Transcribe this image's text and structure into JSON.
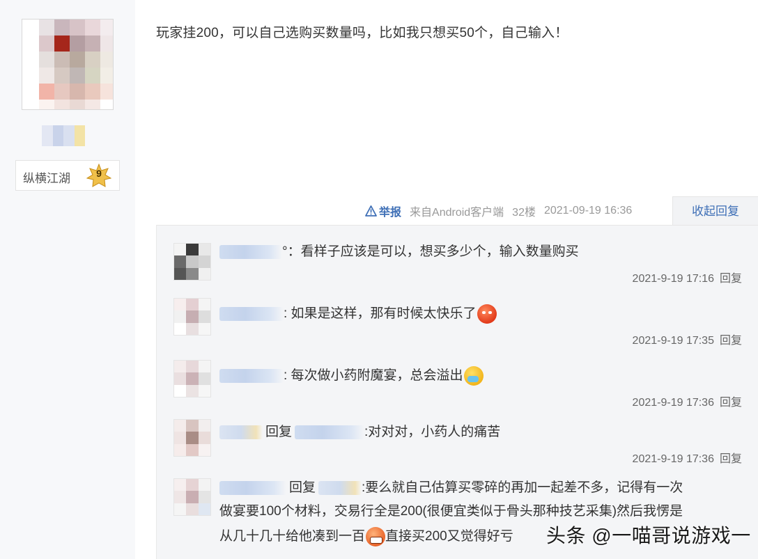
{
  "author": {
    "rank_title": "纵横江湖",
    "rank_level": "9"
  },
  "post": {
    "content": "玩家挂200，可以自己选购买数量吗，比如我只想买50个，自己输入！",
    "report_label": "举报",
    "source": "来自Android客户端",
    "floor": "32楼",
    "time": "2021-09-19 16:36",
    "collapse_label": "收起回复"
  },
  "comments": [
    {
      "text": "°：看样子应该是可以，想买多少个，输入数量购买",
      "time": "2021-9-19 17:16",
      "reply_label": "回复"
    },
    {
      "text": ": 如果是这样，那有时候太快乐了",
      "emoji": "angry-face",
      "time": "2021-9-19 17:35",
      "reply_label": "回复"
    },
    {
      "text": ": 每次做小药附魔宴，总会溢出",
      "emoji": "sick-face",
      "time": "2021-9-19 17:36",
      "reply_label": "回复"
    },
    {
      "reply_word": "回复",
      "text": ":对对对，小药人的痛苦",
      "time": "2021-9-19 17:36",
      "reply_label": "回复"
    },
    {
      "reply_word": "回复",
      "line1": ":要么就自己估算买零碎的再加一起差不多，记得有一次",
      "line2": "做宴要100个材料，交易行全是200(很便宜类似于骨头那种技艺采集)然后我愣是",
      "line3a": "从几十几十给他凑到一百",
      "emoji": "grin-face",
      "line3b": "直接买200又觉得好亏"
    }
  ],
  "watermark": "头条 @一喵哥说游戏一"
}
